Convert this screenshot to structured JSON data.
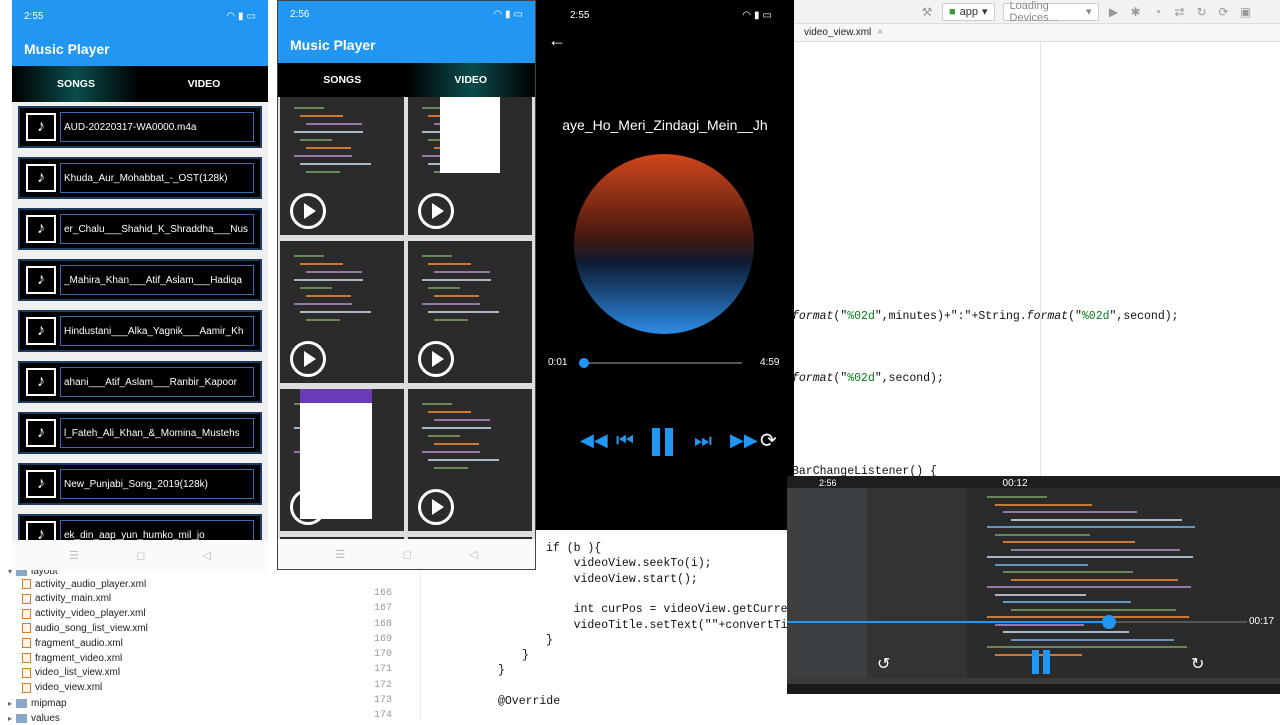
{
  "ide": {
    "toolbar": {
      "run_config": "app",
      "device_selector": "Loading Devices...",
      "dropdown_arrow": "▾"
    },
    "editor_tab": "video_view.xml",
    "code_lines_right": [
      {
        "text_parts": [
          [
            "format",
            "it"
          ],
          [
            "(\"",
            ""
          ],
          [
            "%02d",
            "str"
          ],
          [
            "\",minutes)+\":\"+String.",
            ""
          ],
          [
            "format",
            "it"
          ],
          [
            "(\"",
            ""
          ],
          [
            "%02d",
            "str"
          ],
          [
            "\",second);",
            ""
          ]
        ]
      },
      {
        "text_parts": [
          [
            "format",
            "it"
          ],
          [
            "(\"",
            ""
          ],
          [
            "%02d",
            "str"
          ],
          [
            "\",second);",
            ""
          ]
        ]
      },
      {
        "text_parts": [
          [
            "BarChangeListener() {",
            ""
          ]
        ]
      }
    ],
    "code_block": [
      {
        "num": "",
        "text": "if (b ){"
      },
      {
        "num": "",
        "text": "    videoView.seekTo(i);"
      },
      {
        "num": "",
        "text": "    videoView.start();"
      },
      {
        "num": "166",
        "text": ""
      },
      {
        "num": "167",
        "text": "    int curPos = videoView.getCurrentPo"
      },
      {
        "num": "168",
        "text": "    videoTitle.setText(\"\"+convertTime("
      },
      {
        "num": "169",
        "text": "}"
      },
      {
        "num": "170",
        "text": "}"
      },
      {
        "num": "171",
        "text": "}"
      },
      {
        "num": "172",
        "text": ""
      },
      {
        "num": "173",
        "text": "@Override"
      },
      {
        "num": "174",
        "text": ""
      }
    ],
    "project_tree": {
      "folder_layout": "layout",
      "files": [
        "activity_audio_player.xml",
        "activity_main.xml",
        "activity_video_player.xml",
        "audio_song_list_view.xml",
        "fragment_audio.xml",
        "fragment_video.xml",
        "video_list_view.xml",
        "video_view.xml"
      ],
      "folder_mipmap": "mipmap",
      "folder_values": "values"
    }
  },
  "phone1": {
    "time": "2:55",
    "app_title": "Music Player",
    "tabs": [
      {
        "label": "SONGS",
        "active": true
      },
      {
        "label": "VIDEO",
        "active": false
      }
    ],
    "songs": [
      "AUD-20220317-WA0000.m4a",
      "Khuda_Aur_Mohabbat_-_OST(128k)",
      "er_Chalu___Shahid_K_Shraddha___Nus",
      "_Mahira_Khan___Atif_Aslam___Hadiqa",
      "Hindustani___Alka_Yagnik___Aamir_Kh",
      "ahani___Atif_Aslam___Ranbir_Kapoor",
      "l_Fateh_Ali_Khan_&_Momina_Mustehs",
      "New_Punjabi_Song_2019(128k)",
      "ek_din_aap_yun_humko_mil_jo"
    ],
    "nav": [
      "☰",
      "◻",
      "◁"
    ]
  },
  "phone2": {
    "time": "2:56",
    "app_title": "Music Player",
    "tabs": [
      {
        "label": "SONGS",
        "active": false
      },
      {
        "label": "VIDEO",
        "active": true
      }
    ],
    "nav": [
      "☰",
      "◻",
      "◁"
    ]
  },
  "player": {
    "time": "2:55",
    "song_title": "aye_Ho_Meri_Zindagi_Mein__Jh",
    "current_time": "0:01",
    "total_time": "4:59",
    "progress_fraction": 0.0,
    "controls": [
      "rewind",
      "previous",
      "pause",
      "next",
      "fast-forward",
      "repeat"
    ]
  },
  "video_player": {
    "time": "2:56",
    "current_time": "00:12",
    "total_time": "00:17",
    "progress_fraction": 0.7
  }
}
